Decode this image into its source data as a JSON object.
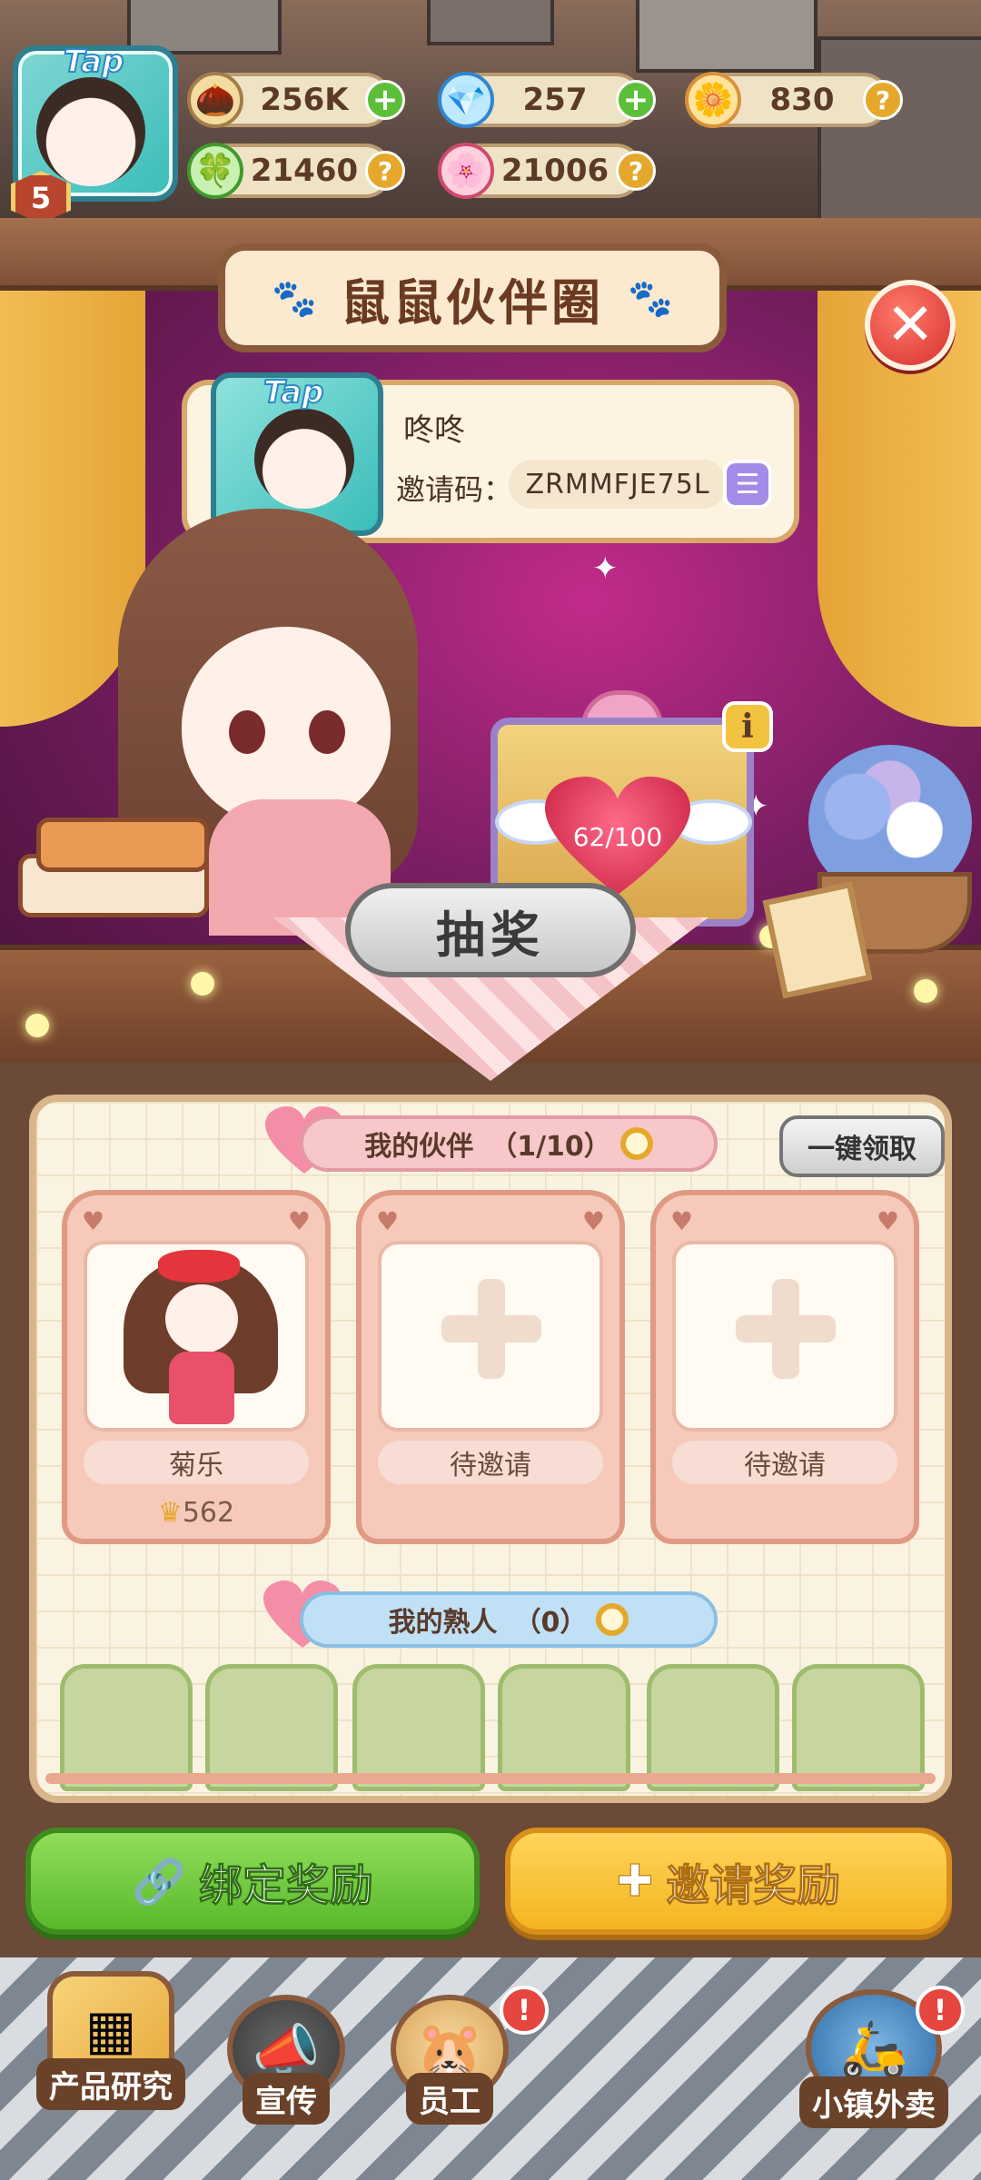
{
  "player": {
    "badge": "Tap",
    "level": "5"
  },
  "resources": [
    {
      "name": "seeds",
      "value": "256K",
      "icon": "seed-icon",
      "action": "+"
    },
    {
      "name": "diamonds",
      "value": "257",
      "icon": "diamond-icon",
      "action": "+"
    },
    {
      "name": "flowers",
      "value": "830",
      "icon": "flower-icon",
      "action": "?"
    },
    {
      "name": "clovers",
      "value": "21460",
      "icon": "clover-icon",
      "action": "?"
    },
    {
      "name": "sakura",
      "value": "21006",
      "icon": "sakura-icon",
      "action": "?"
    }
  ],
  "dialog": {
    "title": "鼠鼠伙伴圈",
    "close_icon": "✕"
  },
  "profile": {
    "badge": "Tap",
    "name": "咚咚",
    "invite_label": "邀请码：",
    "invite_code": "ZRMMFJE75L",
    "copy_icon": "copy-icon"
  },
  "gift": {
    "progress": "62/100",
    "progress_value": 62,
    "progress_max": 100,
    "info_label": "i"
  },
  "draw_button": "抽奖",
  "partners": {
    "title": "我的伙伴",
    "count": "（1/10）",
    "claim_all": "一键领取",
    "slots": [
      {
        "name": "菊乐",
        "filled": true,
        "score": "562"
      },
      {
        "name": "待邀请",
        "filled": false
      },
      {
        "name": "待邀请",
        "filled": false
      }
    ]
  },
  "acquaintances": {
    "title": "我的熟人",
    "count": "（0）",
    "slot_count": 6
  },
  "actions": {
    "bind_reward": "绑定奖励",
    "invite_reward": "邀请奖励"
  },
  "nav": [
    {
      "label": "产品研究",
      "icon": "product-research-icon"
    },
    {
      "label": "宣传",
      "icon": "megaphone-icon"
    },
    {
      "label": "员工",
      "icon": "hamster-icon",
      "badge": "!"
    },
    {
      "label": "小镇外卖",
      "icon": "scooter-icon",
      "badge": "!"
    }
  ],
  "colors": {
    "accent_green": "#58b92b",
    "accent_yellow": "#f4b521",
    "close_red": "#d62f2f",
    "stage_magenta": "#c22b8b"
  }
}
